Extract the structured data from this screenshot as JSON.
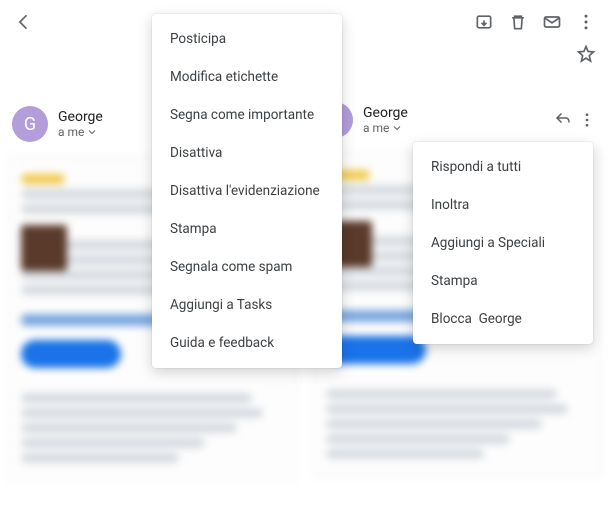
{
  "sender": {
    "avatar_initial": "G",
    "name": "George",
    "to_line": "a me"
  },
  "left_menu": {
    "items": [
      "Posticipa",
      "Modifica etichette",
      "Segna come importante",
      "Disattiva",
      "Disattiva l'evidenziazione",
      "Stampa",
      "Segnala come spam",
      "Aggiungi a Tasks",
      "Guida e feedback"
    ]
  },
  "right_menu": {
    "items": [
      "Rispondi a tutti",
      "Inoltra",
      "Aggiungi a Speciali",
      "Stampa",
      "Blocca  George"
    ]
  }
}
